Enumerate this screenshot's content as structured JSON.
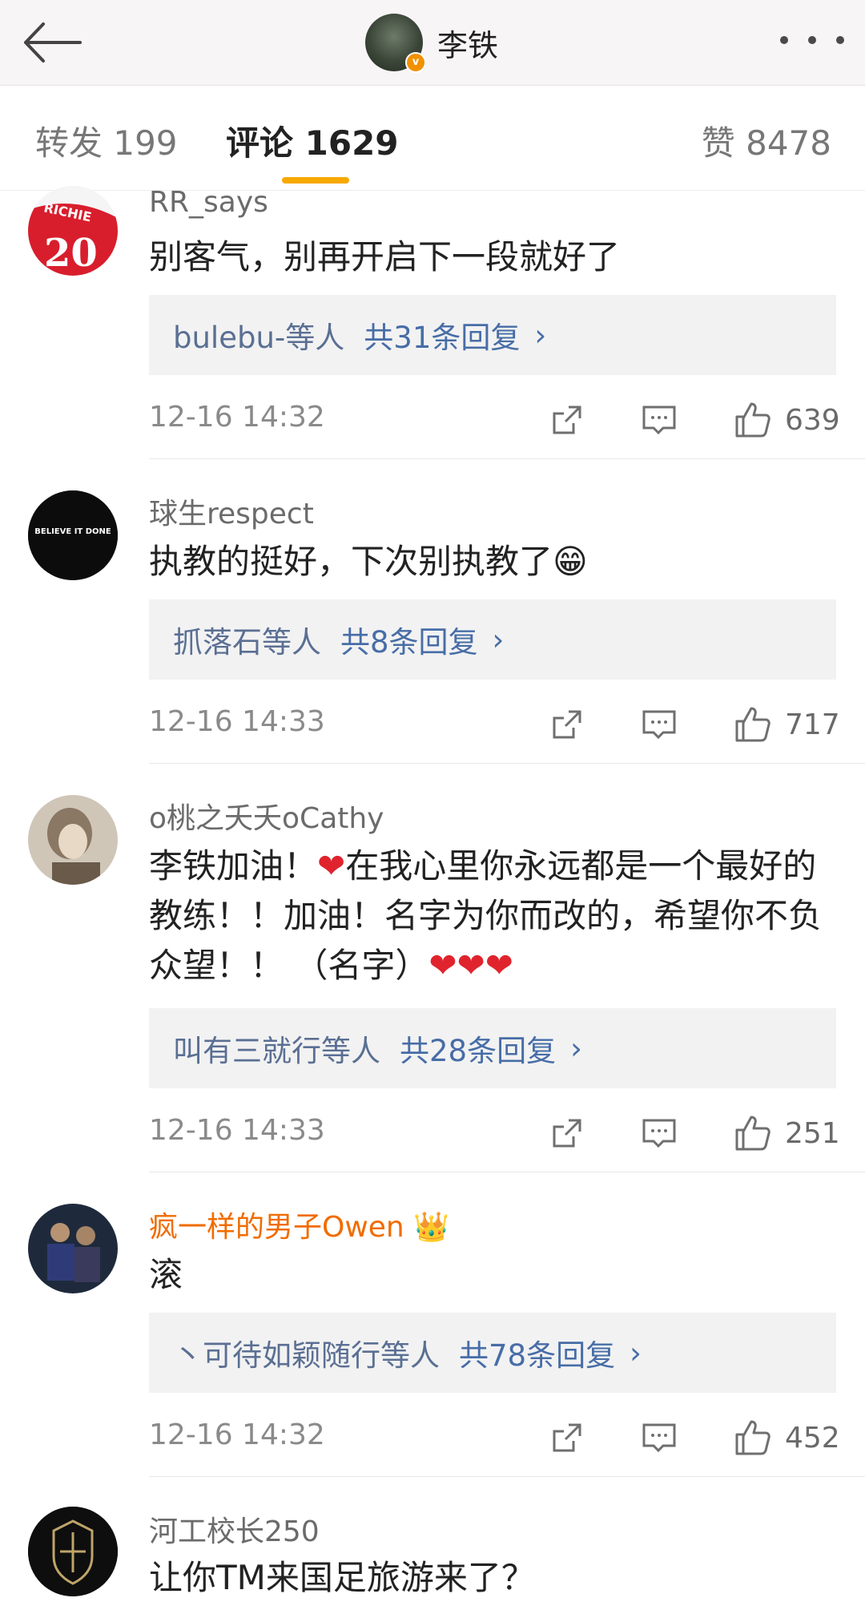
{
  "header": {
    "title": "李铁",
    "verified_badge": "v",
    "icons": {
      "back": "arrow-left-icon",
      "more": "more-dots-icon"
    }
  },
  "tabs": [
    {
      "label": "转发 199"
    },
    {
      "label": "评论 1629",
      "active": true
    },
    {
      "label": "赞 8478"
    }
  ],
  "comments": [
    {
      "user": "RR_says",
      "text": "别客气，别再开启下一段就好了",
      "reply_users": "bulebu-等人",
      "reply_count": "共31条回复",
      "time": "12-16 14:32",
      "likes": "639"
    },
    {
      "user": "球生respect",
      "text": "执教的挺好，下次别执教了",
      "emoji": "😁",
      "reply_users": "抓落石等人",
      "reply_count": "共8条回复",
      "time": "12-16 14:33",
      "likes": "717"
    },
    {
      "user": "o桃之夭夭oCathy",
      "text_part1": "李铁加油！",
      "text_part2": "在我心里你永远都是一个最好的教练！！加油！名字为你而改的，希望你不负众望！！ （名字）",
      "heart": "❤",
      "hearts": "❤❤❤",
      "reply_users": "叫有三就行等人",
      "reply_count": "共28条回复",
      "time": "12-16 14:33",
      "likes": "251"
    },
    {
      "user": "疯一样的男子Owen",
      "crown": "👑",
      "text": "滚",
      "reply_users": "丶可待如颖随行等人",
      "reply_count": "共78条回复",
      "time": "12-16 14:32",
      "likes": "452"
    },
    {
      "user": "河工校长250",
      "text": "让你TM来国足旅游来了？"
    }
  ],
  "avatar_texts": {
    "richie": "RICHIE",
    "richie_num": "20",
    "believe": "BELIEVE IT DONE"
  },
  "reply_arrow": "›",
  "colors": {
    "accent": "#f7a900",
    "link": "#476da7",
    "vip_name": "#f06c00"
  }
}
